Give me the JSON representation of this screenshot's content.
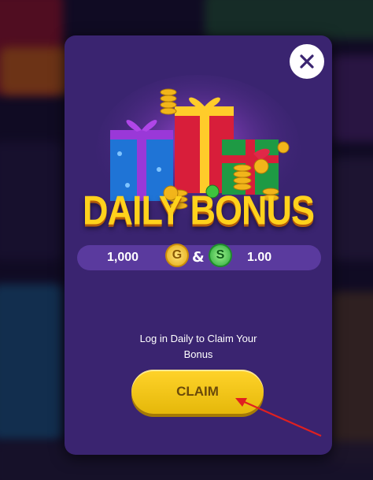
{
  "colors": {
    "modal_bg": "#3a2470",
    "title_gold": "#ffd21c",
    "bar_bg": "#5a3a9e",
    "claim_yellow": "#ffd32a",
    "annotation_red": "#e02020"
  },
  "popup": {
    "title": "DAILY BONUS",
    "close_icon": "close-icon",
    "reward": {
      "gold_amount": "1,000",
      "gold_coin_letter": "G",
      "separator": "&",
      "sweeps_coin_letter": "S",
      "sweeps_amount": "1.00"
    },
    "message_line1": "Log in Daily to Claim Your",
    "message_line2": "Bonus",
    "claim_label": "CLAIM"
  }
}
